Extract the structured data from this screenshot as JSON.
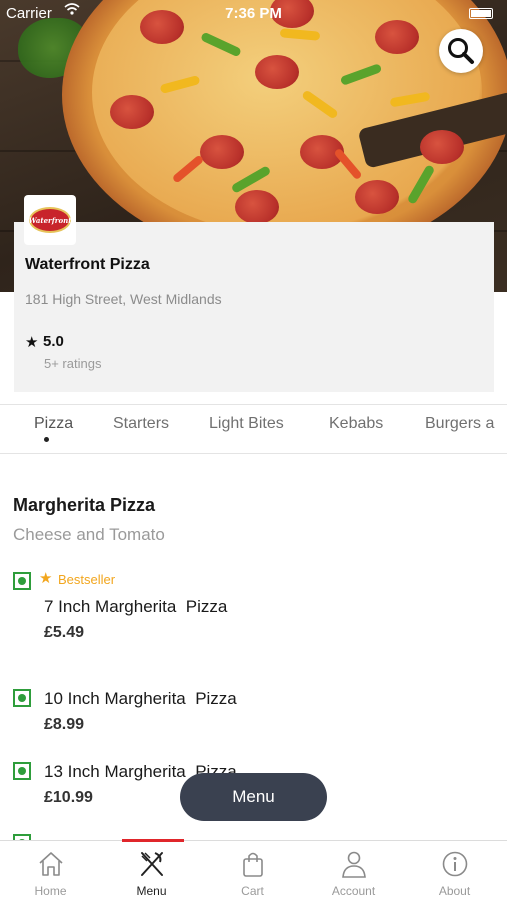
{
  "status_bar": {
    "carrier": "Carrier",
    "time": "7:36 PM"
  },
  "restaurant": {
    "name": "Waterfront Pizza",
    "logo_text": "Waterfront",
    "address": "181 High Street, West Midlands",
    "rating": "5.0",
    "rating_count": "5+ ratings"
  },
  "categories": [
    "Pizza",
    "Starters",
    "Light Bites",
    "Kebabs",
    "Burgers a"
  ],
  "active_category": "Pizza",
  "section": {
    "title": "Margherita Pizza",
    "subtitle": "Cheese and Tomato"
  },
  "items": [
    {
      "badge": "Bestseller",
      "name": "7 Inch Margherita  Pizza",
      "price": "£5.49"
    },
    {
      "name": "10 Inch Margherita  Pizza",
      "price": "£8.99"
    },
    {
      "name": "13 Inch Margherita  Pizza",
      "price": "£10.99"
    }
  ],
  "menu_button": "Menu",
  "bottom_nav": [
    {
      "label": "Home",
      "icon": "home-icon"
    },
    {
      "label": "Menu",
      "icon": "cutlery-icon",
      "active": true
    },
    {
      "label": "Cart",
      "icon": "shopping-bag-icon"
    },
    {
      "label": "Account",
      "icon": "person-icon"
    },
    {
      "label": "About",
      "icon": "info-icon"
    }
  ],
  "colors": {
    "accent": "#e0262b",
    "veg": "#2e9d3b",
    "bestseller": "#f2a61e",
    "fab": "#3a4150"
  }
}
